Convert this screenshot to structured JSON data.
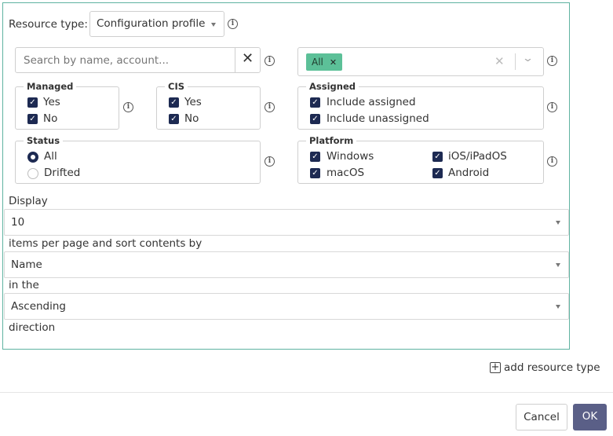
{
  "filters": {
    "resource_type_label": "Resource type:",
    "resource_type_value": "Configuration profile",
    "search_placeholder": "Search by name, account...",
    "search_value": "",
    "tag_value": "All",
    "managed": {
      "legend": "Managed",
      "options": [
        {
          "label": "Yes",
          "checked": true
        },
        {
          "label": "No",
          "checked": true
        }
      ]
    },
    "cis": {
      "legend": "CIS",
      "options": [
        {
          "label": "Yes",
          "checked": true
        },
        {
          "label": "No",
          "checked": true
        }
      ]
    },
    "assigned": {
      "legend": "Assigned",
      "options": [
        {
          "label": "Include assigned",
          "checked": true
        },
        {
          "label": "Include unassigned",
          "checked": true
        }
      ]
    },
    "status": {
      "legend": "Status",
      "options": [
        {
          "label": "All",
          "selected": true
        },
        {
          "label": "Drifted",
          "selected": false
        }
      ]
    },
    "platform": {
      "legend": "Platform",
      "options": [
        {
          "label": "Windows",
          "checked": true
        },
        {
          "label": "iOS/iPadOS",
          "checked": true
        },
        {
          "label": "macOS",
          "checked": true
        },
        {
          "label": "Android",
          "checked": true
        }
      ]
    }
  },
  "display": {
    "prefix": "Display",
    "items_per_page": "10",
    "mid1": "items per page and sort contents by",
    "sort_by": "Name",
    "mid2": "in the",
    "direction": "Ascending",
    "suffix": "direction"
  },
  "actions": {
    "add_resource_type": "add resource type",
    "cancel": "Cancel",
    "ok": "OK"
  },
  "colors": {
    "panel_border": "#5fb3a1",
    "tag_bg": "#5cc098",
    "checkbox": "#1d2a52",
    "ok_button": "#5a5f87"
  }
}
